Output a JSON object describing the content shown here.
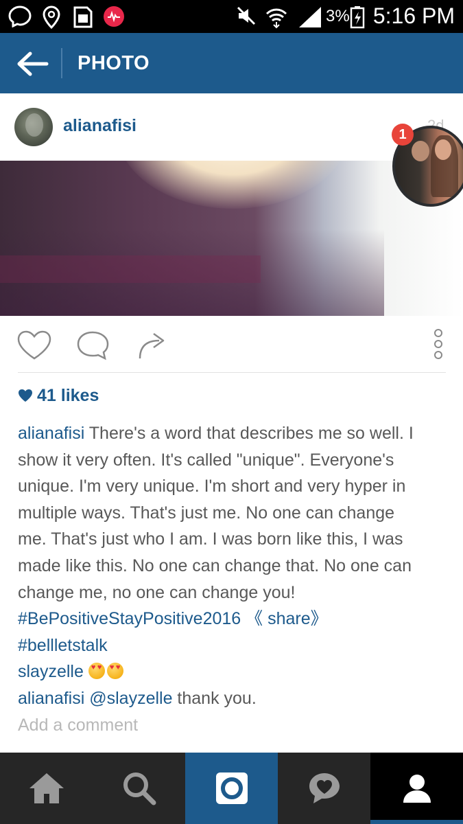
{
  "status_bar": {
    "time": "5:16 PM",
    "battery_percent": "3%",
    "icons": [
      "messenger-icon",
      "location-icon",
      "sim-icon",
      "musically-icon",
      "mute-icon",
      "wifi-icon",
      "signal-icon",
      "battery-icon"
    ]
  },
  "app_bar": {
    "title": "PHOTO"
  },
  "post": {
    "username": "alianafisi",
    "timestamp": "2d",
    "chat_head_badge": "1",
    "likes_label": "41 likes",
    "caption_user": "alianafisi",
    "caption_lines": [
      " There's a word that describes me so well. I",
      "show it very often. It's called \"unique\". Everyone's",
      "unique. I'm very unique. I'm short and very hyper in",
      "multiple ways. That's just me. No one can change",
      "me. That's just who I am. I was born like this, I was",
      "made like this. No one can change that. No one can",
      "change me, no one can change you!"
    ],
    "hashtag1": "#BePositiveStayPositive2016",
    "share_text": " 《 share》",
    "hashtag2": "#bellletstalk",
    "comments": [
      {
        "user": "slayzelle",
        "mention": "",
        "text": " "
      },
      {
        "user": "alianafisi",
        "mention": " @slayzelle",
        "text": " thank you."
      }
    ],
    "add_comment_placeholder": "Add a comment"
  },
  "colors": {
    "brand": "#1d5a8c",
    "nav_bg": "#262626",
    "nav_active": "#1d5a8c"
  }
}
